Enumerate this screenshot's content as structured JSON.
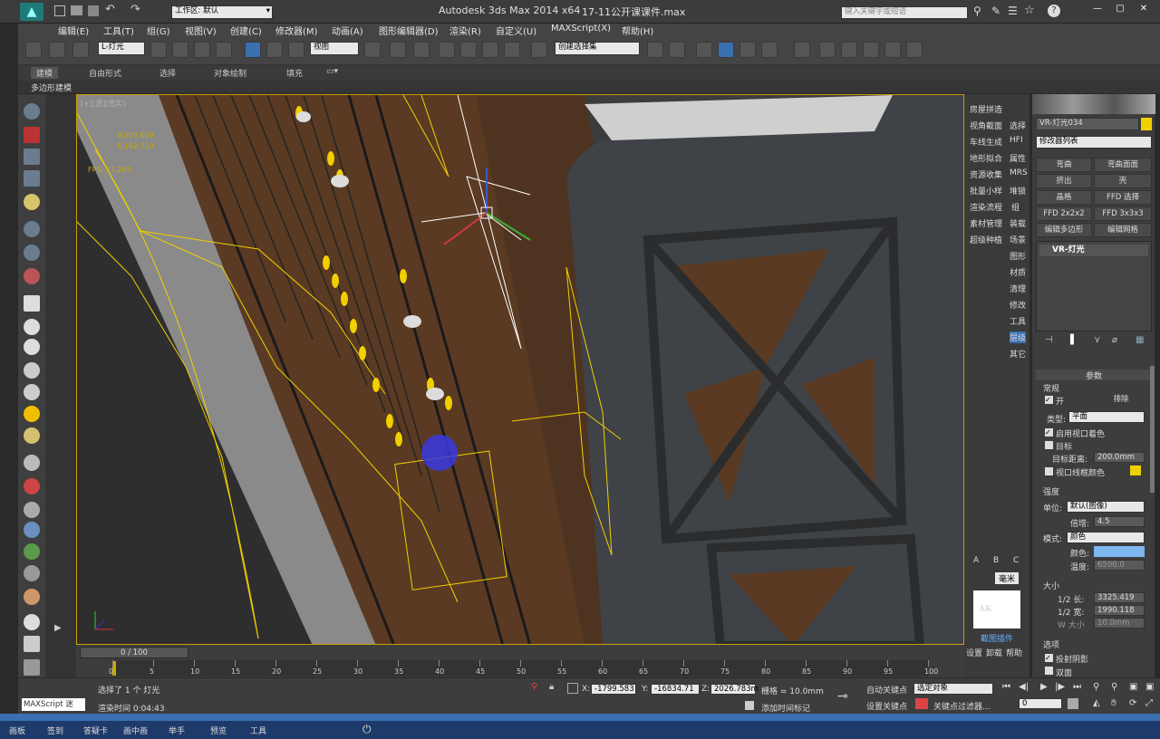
{
  "title": {
    "workspace": "工作区: 默认",
    "app": "Autodesk 3ds Max  2014 x64",
    "file": "17-11公开课课件.max",
    "search_placeholder": "键入关键字或短语"
  },
  "menu": [
    "编辑(E)",
    "工具(T)",
    "组(G)",
    "视图(V)",
    "创建(C)",
    "修改器(M)",
    "动画(A)",
    "图形编辑器(D)",
    "渲染(R)",
    "自定义(U)",
    "MAXScript(X)",
    "帮助(H)"
  ],
  "toolbar": {
    "filter": "L-灯光",
    "refcoord": "视图",
    "selset": "创建选择集"
  },
  "ribbon": {
    "tabs": [
      "建模",
      "自由形式",
      "选择",
      "对象绘制",
      "填充"
    ],
    "sub": "多边形建模"
  },
  "viewport": {
    "stats": [
      "9,003,660",
      "5,182,710",
      "FPS: 37.269"
    ]
  },
  "cmd_left": [
    "房屋拼造",
    "视角截面",
    "车线生成",
    "地形拟合",
    "资源收集",
    "批量小样",
    "渲染流程",
    "素材管理",
    "超级种植"
  ],
  "cmd_right": [
    "选择",
    "HFI",
    "属性",
    "MRS",
    "堆锁",
    "组",
    "装载",
    "场景",
    "图形",
    "材质",
    "清理",
    "修改",
    "工具",
    "层级",
    "其它"
  ],
  "cmd_bottom": {
    "tabs": [
      "A",
      "B",
      "C"
    ],
    "unit": "毫米",
    "logo": "AK",
    "logo_sub": "截图插件",
    "links": [
      "设置",
      "卸载",
      "帮助"
    ]
  },
  "panel": {
    "name": "VR-灯光034",
    "modlist": "修改器列表",
    "buttons": [
      "弯曲",
      "弯曲面面",
      "挤出",
      "壳",
      "晶格",
      "FFD 选择",
      "FFD 2x2x2",
      "FFD 3x3x3",
      "编辑多边形",
      "编辑网格"
    ],
    "stack_item": "VR-灯光",
    "rollout": "参数",
    "general": "常规",
    "on": "开",
    "exclude": "排除",
    "type_label": "类型:",
    "type": "平面",
    "viewport_shading": "启用视口着色",
    "target": "目标",
    "target_dist_label": "目标距离:",
    "target_dist": "200.0mm",
    "wire_color": "视口线框颜色",
    "intensity": "强度",
    "unit_label": "单位:",
    "unit": "默认(图像)",
    "mult_label": "倍增:",
    "mult": "4.5",
    "mode_label": "模式:",
    "mode": "颜色",
    "color_label": "颜色:",
    "temp_label": "温度:",
    "temp": "6500.0",
    "size": "大小",
    "half_len_label": "1/2 长:",
    "half_len": "3325.419",
    "half_wid_label": "1/2 宽:",
    "half_wid": "1990.118",
    "w_size_label": "W 大小",
    "w_size": "10.0mm",
    "options": "选项",
    "cast_shadow": "投射阴影",
    "double": "双面"
  },
  "timeline": {
    "frame": "0 / 100",
    "ticks": [
      "0",
      "5",
      "10",
      "15",
      "20",
      "25",
      "30",
      "35",
      "40",
      "45",
      "50",
      "55",
      "60",
      "65",
      "70",
      "75",
      "80",
      "85",
      "90",
      "95",
      "100"
    ]
  },
  "status": {
    "script": "MAXScript 迷",
    "selected": "选择了 1 个 灯光",
    "render_time": "渲染时间 0:04:43",
    "x": "-1799.583",
    "y": "-16834.71",
    "z": "2026.783m",
    "grid": "栅格 = 10.0mm",
    "add_time_tag": "添加时间标记",
    "auto_key": "自动关键点",
    "set_key": "设置关键点",
    "sel_obj": "选定对象",
    "key_filters": "关键点过滤器...",
    "frame": "0"
  },
  "taskbar": [
    "画板",
    "签到",
    "答疑卡",
    "画中画",
    "举手",
    "预览",
    "工具"
  ],
  "colors": {
    "light_color": "#7eb6f0",
    "wire_color": "#f0d000",
    "accent": "#3a7ad0"
  }
}
